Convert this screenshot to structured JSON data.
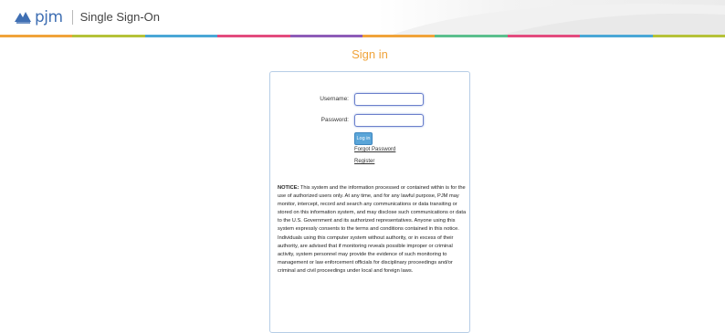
{
  "header": {
    "logo_text": "pjm",
    "app_title": "Single Sign-On",
    "stripe_colors": [
      "#f0a33a",
      "#b5c238",
      "#4aa7d6",
      "#e34b7e",
      "#8e5cb8",
      "#f0a33a",
      "#5bbf8e",
      "#e34b7e",
      "#4aa7d6",
      "#b5c238"
    ]
  },
  "signin": {
    "title": "Sign in",
    "username_label": "Username:",
    "username_value": "",
    "password_label": "Password:",
    "password_value": "",
    "login_button": "Log in",
    "forgot_password": "Forgot Password",
    "register": "Register"
  },
  "notice": {
    "label": "NOTICE:",
    "text": "This system and the information processed or contained within is for the use of authorized users only. At any time, and for any lawful purpose, PJM may monitor, intercept, record and search any communications or data transiting or stored on this information system, and may disclose such communications or data to the U.S. Government and its authorized representatives. Anyone using this system expressly consents to the terms and conditions contained in this notice. Individuals using this computer system without authority, or in excess of their authority, are advised that if monitoring reveals possible improper or criminal activity, system personnel may provide the evidence of such monitoring to management or law enforcement officials for disciplinary proceedings and/or criminal and civil proceedings under local and foreign laws."
  },
  "colors": {
    "accent_orange": "#f0a33a",
    "brand_blue": "#3f6fb3",
    "button_blue": "#5aa5d8",
    "box_border": "#b6cde6"
  }
}
